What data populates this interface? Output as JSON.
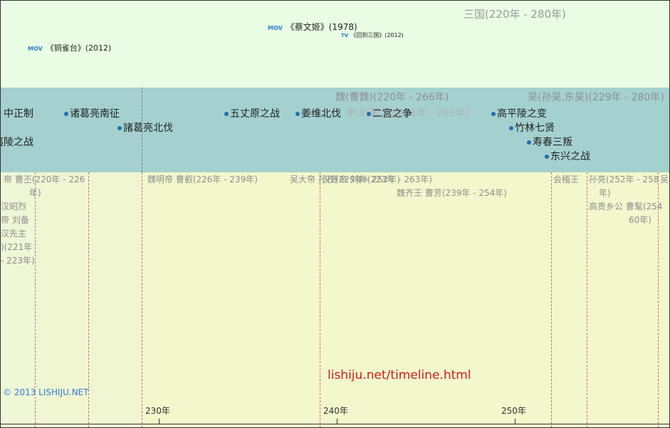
{
  "era": {
    "title": "三国(220年 - 280年)"
  },
  "media": [
    {
      "tag": "MOV",
      "title": "《蔡文姬》(1978)"
    },
    {
      "tag": "TV",
      "title": "《回到三国》(2012)"
    },
    {
      "tag": "MOV",
      "title": "《铜雀台》(2012)"
    }
  ],
  "kingdoms": [
    {
      "label": "魏(曹魏)(220年 - 266年)"
    },
    {
      "label": "季汉(蜀汉)(221年 - 263年)"
    },
    {
      "label": "吴(孙吴,东吴)(229年 - 280年)"
    }
  ],
  "events": [
    {
      "label": "中正制"
    },
    {
      "label": "夷陵之战"
    },
    {
      "label": "诸葛亮南征"
    },
    {
      "label": "諸葛亮北伐"
    },
    {
      "label": "五丈原之战"
    },
    {
      "label": "姜维北伐"
    },
    {
      "label": "二宫之争"
    },
    {
      "label": "高平陵之变"
    },
    {
      "label": "竹林七贤"
    },
    {
      "label": "寿春三叛"
    },
    {
      "label": "东兴之战"
    }
  ],
  "rulers": [
    {
      "line1": "帝 曹丕(220年 - 226",
      "line2": "年)"
    },
    {
      "lines": [
        "汉昭烈",
        "帝 刘备",
        "汉先主",
        ")(221年",
        "- 223年)"
      ]
    },
    {
      "line1": "魏明帝 曹叡(226年 - 239年)"
    },
    {
      "line1": "吴大帝 孙权(229年 - 252年)"
    },
    {
      "line1": "汉怀帝 刘禅(223年 - 263年)"
    },
    {
      "line1": "魏齐王 曹芳(239年 - 254年)"
    },
    {
      "line1": "会稽王"
    },
    {
      "line1": "孙亮(252年 - 258",
      "line2": "年)"
    },
    {
      "line1": "高贵乡公 曹髦(254",
      "line2": "60年)"
    },
    {
      "line1": "吴"
    }
  ],
  "axis": {
    "labels": [
      "230年",
      "240年",
      "250年"
    ]
  },
  "watermark": "lishiju.net/timeline.html",
  "copyright": "© 2013 LISHIJU.NET"
}
